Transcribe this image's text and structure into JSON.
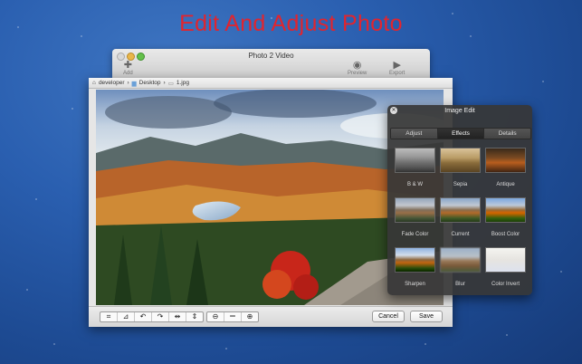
{
  "headline": "Edit And Adjust Photo",
  "back_window": {
    "title": "Photo 2 Video",
    "toolbar": [
      {
        "label": "Add",
        "icon": "plus-icon"
      },
      {
        "label": "Preview",
        "icon": "eye-icon"
      },
      {
        "label": "Export",
        "icon": "export-icon"
      }
    ]
  },
  "main_window": {
    "path": [
      "developer",
      "Desktop",
      "1.jpg"
    ],
    "tools": [
      "crop-icon",
      "straighten-icon",
      "rotate-left-icon",
      "rotate-right-icon",
      "flip-horizontal-icon",
      "flip-vertical-icon"
    ],
    "zoom_tools": [
      "zoom-out-icon",
      "fit-icon",
      "zoom-in-icon"
    ],
    "cancel_label": "Cancel",
    "save_label": "Save"
  },
  "panel": {
    "title": "Image Edit",
    "tabs": [
      "Adjust",
      "Effects",
      "Details"
    ],
    "active_tab": "Effects",
    "effects": [
      "B & W",
      "Sepia",
      "Antique",
      "Fade Color",
      "Current",
      "Boost Color",
      "Sharpen",
      "Blur",
      "Color Invert"
    ]
  },
  "colors": {
    "headline": "#e0252f",
    "desktop": "#2a5fb0"
  }
}
